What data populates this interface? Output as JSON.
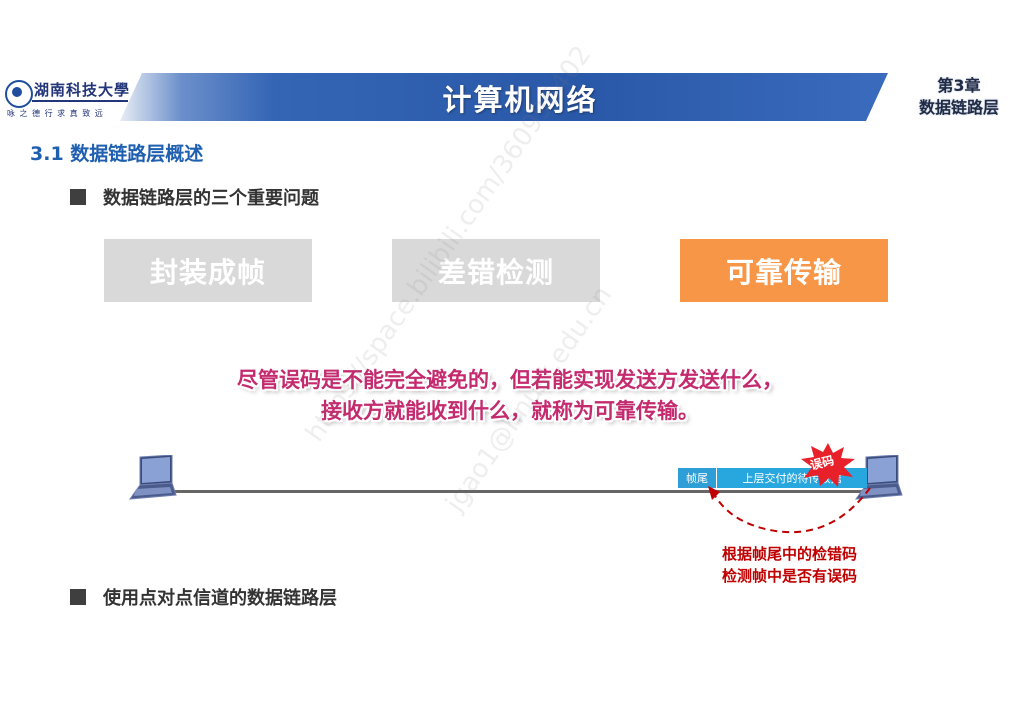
{
  "header": {
    "logo_name": "湖南科技大學",
    "logo_motto": "咏 之 德 行    求 真 致 远",
    "title": "计算机网络",
    "chapter": "第3章",
    "chapter_name": "数据链路层"
  },
  "section": {
    "title": "3.1 数据链路层概述"
  },
  "bullets": [
    {
      "text": "数据链路层的三个重要问题"
    },
    {
      "text": "使用点对点信道的数据链路层"
    }
  ],
  "key_issues": [
    {
      "label": "封装成帧",
      "color": "#d9d9d9"
    },
    {
      "label": "差错检测",
      "color": "#d9d9d9"
    },
    {
      "label": "可靠传输",
      "color": "#f79646"
    }
  ],
  "definition": {
    "line1": "尽管误码是不能完全避免的，但若能实现发送方发送什么，",
    "line2": "接收方就能收到什么，就称为可靠传输。"
  },
  "diagram": {
    "frame_tail": "帧尾",
    "frame_data": "上层交付的待传数据",
    "error_tag": "误码",
    "note_line1": "根据帧尾中的检错码",
    "note_line2": "检测帧中是否有误码"
  },
  "watermark": {
    "line1": "https://space.bilibili.com/360996402",
    "line2": "jgao1@hnust.edu.cn"
  },
  "colors": {
    "accent_blue": "#2a58a8",
    "orange": "#f79646",
    "pink": "#c42a6e",
    "note_red": "#c00000"
  }
}
